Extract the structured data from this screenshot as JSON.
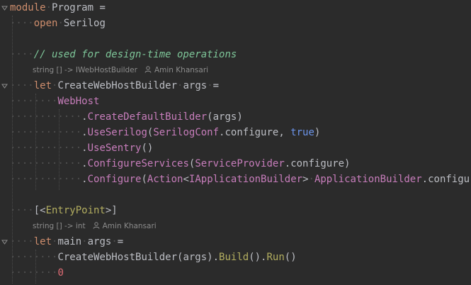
{
  "code": {
    "line1": {
      "kw": "module",
      "name": "Program",
      "eq": " ="
    },
    "line2": {
      "kw": "open",
      "name": "Serilog"
    },
    "line3": {
      "comment": "// used for design-time operations"
    },
    "hint1": {
      "signature": "string [] -> IWebHostBuilder",
      "author": "Amin Khansari"
    },
    "line4": {
      "kw": "let",
      "name": "CreateWebHostBuilder",
      "args": "args",
      "eq": "="
    },
    "line5": {
      "name": "WebHost"
    },
    "line6": {
      "dot": ".",
      "method": "CreateDefaultBuilder",
      "rest": "(args)"
    },
    "line7": {
      "dot": ".",
      "method": "UseSerilog",
      "open": "(",
      "cls": "SerilogConf",
      "rest1": ".configure, ",
      "bool": "true",
      "close": ")"
    },
    "line8": {
      "dot": ".",
      "method": "UseSentry",
      "rest": "()"
    },
    "line9": {
      "dot": ".",
      "method": "ConfigureServices",
      "open": "(",
      "cls": "ServiceProvider",
      "rest": ".configure)"
    },
    "line10": {
      "dot": ".",
      "method": "Configure",
      "open": "(",
      "action": "Action",
      "lt": "<",
      "iface": "IApplicationBuilder",
      "gt": ">",
      "cls": "ApplicationBuilder",
      "rest": ".configure)"
    },
    "line11": {
      "open": "[<",
      "attr": "EntryPoint",
      "close": ">]"
    },
    "hint2": {
      "signature": "string [] -> int",
      "author": "Amin Khansari"
    },
    "line12": {
      "kw": "let",
      "name": "main",
      "args": "args",
      "eq": "="
    },
    "line13": {
      "name": "CreateWebHostBuilder",
      "p1": "(args).",
      "build": "Build",
      "p2": "().",
      "run": "Run",
      "p3": "()"
    },
    "line14": {
      "num": "0"
    }
  },
  "colors": {
    "background": "#2b2b2b",
    "keyword": "#cf8e6d",
    "method": "#c77dbb",
    "comment": "#7ec699",
    "number": "#e06c75",
    "bool": "#6c95eb",
    "hint": "#8c8c8c"
  }
}
